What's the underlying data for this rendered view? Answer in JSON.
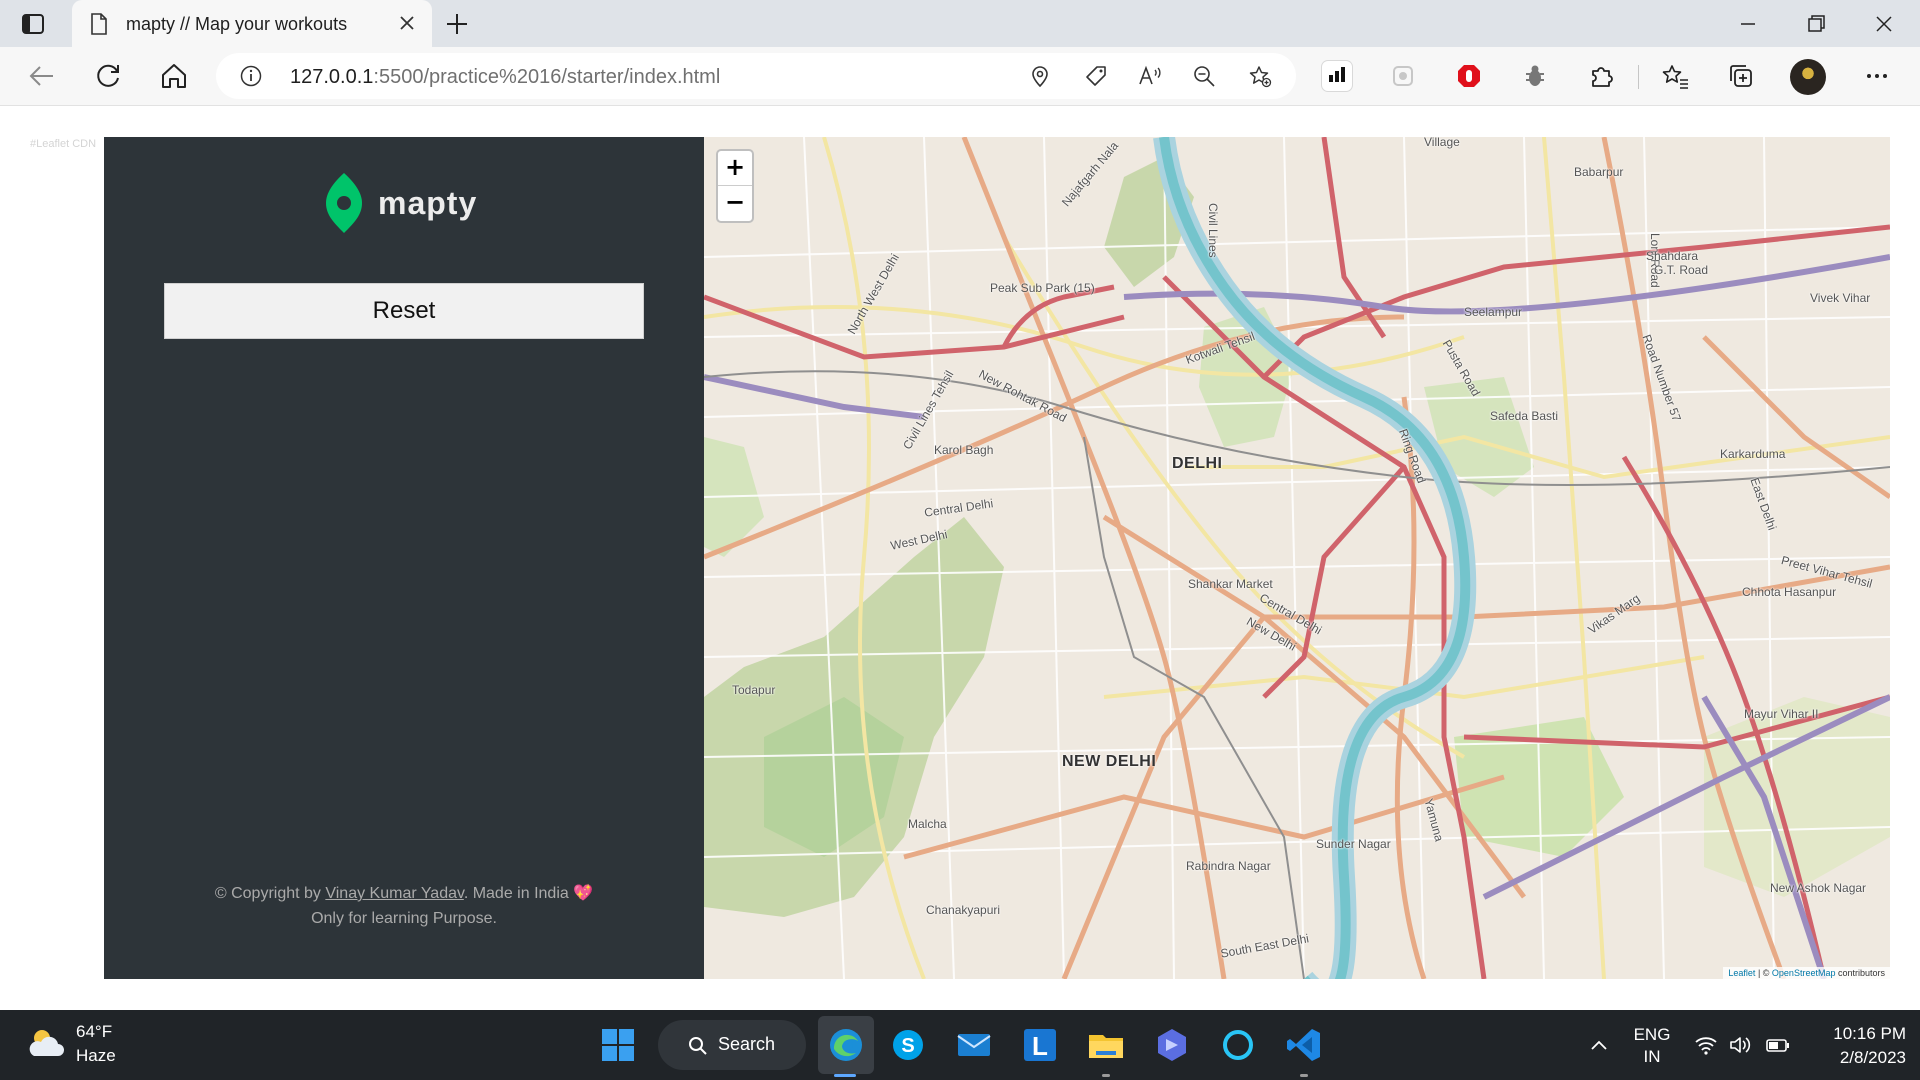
{
  "browser": {
    "tab_title": "mapty // Map your workouts",
    "url_host": "127.0.0.1",
    "url_rest": ":5500/practice%2016/starter/index.html",
    "icons": [
      "tab-actions-icon",
      "document-icon",
      "close-icon",
      "plus-icon",
      "back-arrow-icon",
      "refresh-icon",
      "home-icon",
      "info-icon",
      "location-icon",
      "tag-icon",
      "read-aloud-icon",
      "zoom-out-icon",
      "add-favorite-icon",
      "extension-icons",
      "puzzle-icon",
      "favorites-icon",
      "collections-icon",
      "more-icon"
    ]
  },
  "page": {
    "leaflet_note": "#Leaflet CDN"
  },
  "sidebar": {
    "logo_text": "mapty",
    "reset_label": "Reset",
    "copyright_prefix": "© Copyright by ",
    "author": "Vinay Kumar Yadav",
    "copyright_suffix": ". Made in India ",
    "copyright_line2": "Only for learning Purpose.",
    "accent_color": "#00c46a",
    "background_color": "#2d3439"
  },
  "map": {
    "zoom_in": "+",
    "zoom_out": "−",
    "labels": {
      "delhi": "DELHI",
      "new_delhi": "NEW DELHI",
      "babarpur": "Babarpur",
      "loni_road": "Loni Road",
      "gt_road": "G.T. Road",
      "shahdara": "Shahdara",
      "vivek_vihar": "Vivek Vihar",
      "seelampur": "Seelampur",
      "peak_sub_park": "Peak Sub Park (15)",
      "kotwali_tehsil": "Kotwali Tehsil",
      "new_rohtak_road": "New Rohtak Road",
      "karol_bagh": "Karol Bagh",
      "central_delhi": "Central Delhi",
      "west_delhi": "West Delhi",
      "civil_lines_tehsil": "Civil Lines Tehsil",
      "north_west_delhi": "North West Delhi",
      "najafgarh_nala": "Najafgarh Nala",
      "pusta_road": "Pusta Road",
      "safeda_basti": "Safeda Basti",
      "ring_road": "Ring Road",
      "karkarduma": "Karkarduma",
      "road_number_57": "Road Number 57",
      "east_delhi": "East Delhi",
      "preet_vihar_tehsil": "Preet Vihar Tehsil",
      "chhota_hasanpur": "Chhota Hasanpur",
      "vikas_marg": "Vikas Marg",
      "shankar_market": "Shankar Market",
      "central_delhi_2": "Central Delhi",
      "new_delhi_district": "New Delhi",
      "todapur": "Todapur",
      "mayur_vihar_ii": "Mayur Vihar II",
      "sunder_nagar": "Sunder Nagar",
      "rabindra_nagar": "Rabindra Nagar",
      "chanakyapuri": "Chanakyapuri",
      "malcha": "Malcha",
      "south_east_delhi": "South East Delhi",
      "new_ashok_nagar": "New Ashok Nagar",
      "yamuna": "Yamuna",
      "village": "Village",
      "civil_lines": "Civil Lines"
    },
    "attribution_leaflet": "Leaflet",
    "attribution_sep": " | © ",
    "attribution_osm": "OpenStreetMap",
    "attribution_suffix": " contributors"
  },
  "taskbar": {
    "temperature": "64°F",
    "condition": "Haze",
    "search_label": "Search",
    "lang_line1": "ENG",
    "lang_line2": "IN",
    "time": "10:16 PM",
    "date": "2/8/2023"
  }
}
